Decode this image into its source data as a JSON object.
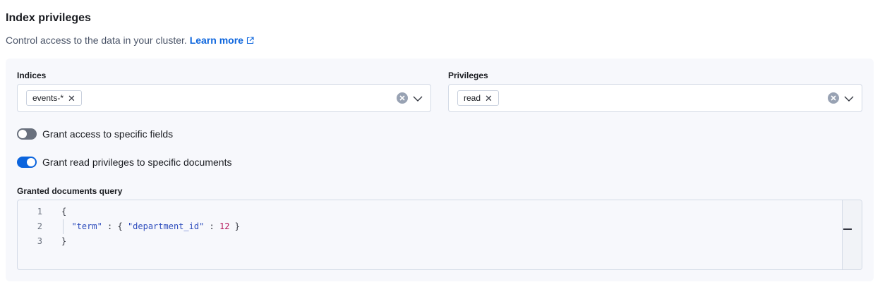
{
  "header": {
    "title": "Index privileges",
    "description": "Control access to the data in your cluster.",
    "learn_more": "Learn more"
  },
  "indices": {
    "label": "Indices",
    "selected": [
      "events-*"
    ]
  },
  "privileges": {
    "label": "Privileges",
    "selected": [
      "read"
    ]
  },
  "toggles": {
    "field_access": {
      "label": "Grant access to specific fields",
      "on": false
    },
    "document_access": {
      "label": "Grant read privileges to specific documents",
      "on": true
    }
  },
  "query": {
    "label": "Granted documents query",
    "line_numbers": [
      "1",
      "2",
      "3"
    ],
    "line1": "{",
    "line2_key": "\"term\"",
    "line2_sep1": " : { ",
    "line2_field": "\"department_id\"",
    "line2_sep2": " : ",
    "line2_value": "12",
    "line2_end": " }",
    "line3": "}"
  },
  "icons": {
    "external_link": "external-link-icon",
    "clear": "clear-icon",
    "chevron": "chevron-down-icon",
    "remove": "cross-icon"
  },
  "colors": {
    "accent": "#0b64dd",
    "panel_bg": "#f7f8fc",
    "string": "#2e4dbd",
    "number": "#b5175a"
  }
}
